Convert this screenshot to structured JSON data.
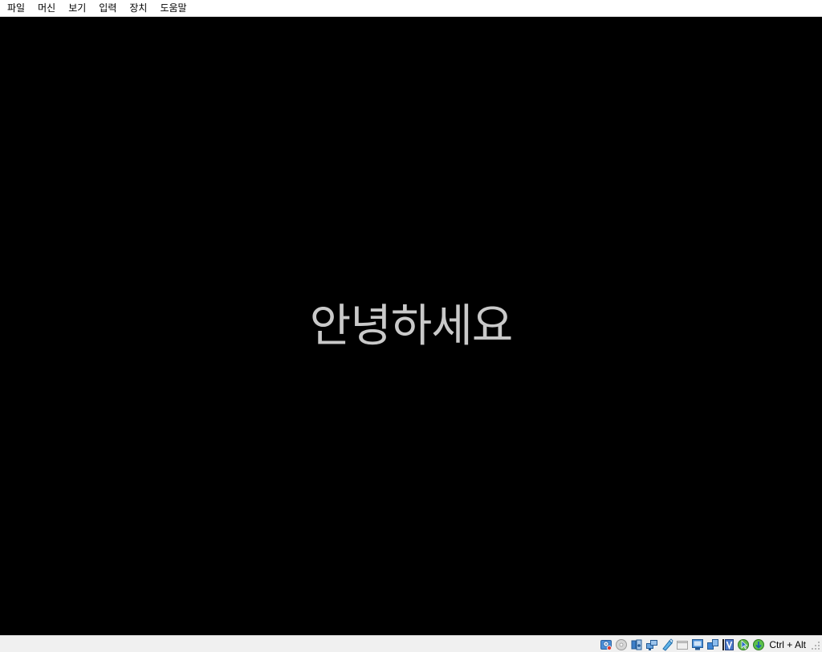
{
  "menubar": {
    "items": [
      "파일",
      "머신",
      "보기",
      "입력",
      "장치",
      "도움말"
    ]
  },
  "screen": {
    "greeting": "안녕하세요"
  },
  "statusbar": {
    "indicators": [
      "hard-disk-icon",
      "optical-drive-icon",
      "audio-icon",
      "network-icon",
      "usb-icon",
      "shared-folders-icon",
      "display-icon",
      "video-capture-icon",
      "virtualization-icon",
      "mouse-integration-icon",
      "keyboard-capture-icon"
    ],
    "host_key": "Ctrl + Alt"
  }
}
